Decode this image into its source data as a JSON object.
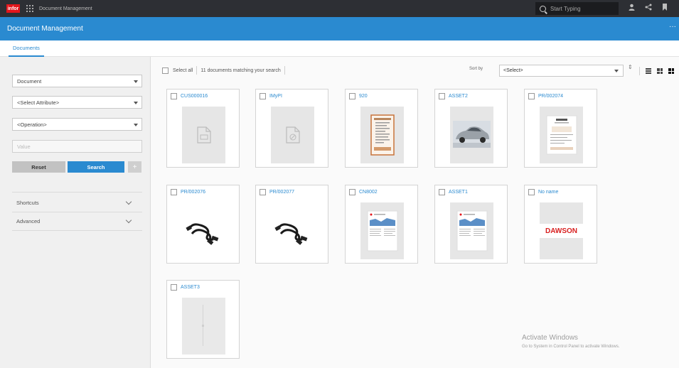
{
  "topbar": {
    "logo_text": "infor",
    "app_name": "Document Management",
    "search_placeholder": "Start Typing",
    "icons": [
      "user-icon",
      "share-icon",
      "bookmark-icon"
    ]
  },
  "header": {
    "title": "Document Management",
    "more_label": "···"
  },
  "tabs": [
    {
      "label": "Documents",
      "active": true
    }
  ],
  "sidebar": {
    "document_type": "Document",
    "attribute_placeholder": "<Select Attribute>",
    "operation_placeholder": "<Operation>",
    "value_placeholder": "Value",
    "reset_label": "Reset",
    "search_label": "Search",
    "add_label": "+",
    "sections": [
      {
        "label": "Shortcuts"
      },
      {
        "label": "Advanced"
      }
    ]
  },
  "toolbar": {
    "select_all_label": "Select all",
    "match_count_text": "11 documents matching your search",
    "sort_by_label": "Sort by",
    "sort_value": "<Select>",
    "sort_order_glyph": "⇕",
    "view_modes": [
      "list-view-icon",
      "grid-view-icon",
      "tile-view-icon"
    ]
  },
  "documents": [
    {
      "name": "CUS000016",
      "thumbnail": "file-generic-icon"
    },
    {
      "name": "IMyPI",
      "thumbnail": "file-blocked-icon"
    },
    {
      "name": "920",
      "thumbnail": "receipt-preview"
    },
    {
      "name": "ASSET2",
      "thumbnail": "car-photo"
    },
    {
      "name": "PR/002074",
      "thumbnail": "invoice-preview"
    },
    {
      "name": "PR/002076",
      "thumbnail": "usb-cable-photo"
    },
    {
      "name": "PR/002077",
      "thumbnail": "usb-cable-photo"
    },
    {
      "name": "CN8002",
      "thumbnail": "brochure-preview"
    },
    {
      "name": "ASSET1",
      "thumbnail": "brochure-preview"
    },
    {
      "name": "No name",
      "thumbnail": "logo-preview",
      "thumbnail_text": "DAWSON"
    },
    {
      "name": "ASSET3",
      "thumbnail": "blank-preview"
    }
  ],
  "watermark": {
    "title": "Activate Windows",
    "subtitle": "Go to System in Control Panel to activate Windows."
  },
  "colors": {
    "accent": "#2a8ad0",
    "topbar": "#2d2f34",
    "logo": "#e3151b",
    "dawson_red": "#d81e1e"
  }
}
